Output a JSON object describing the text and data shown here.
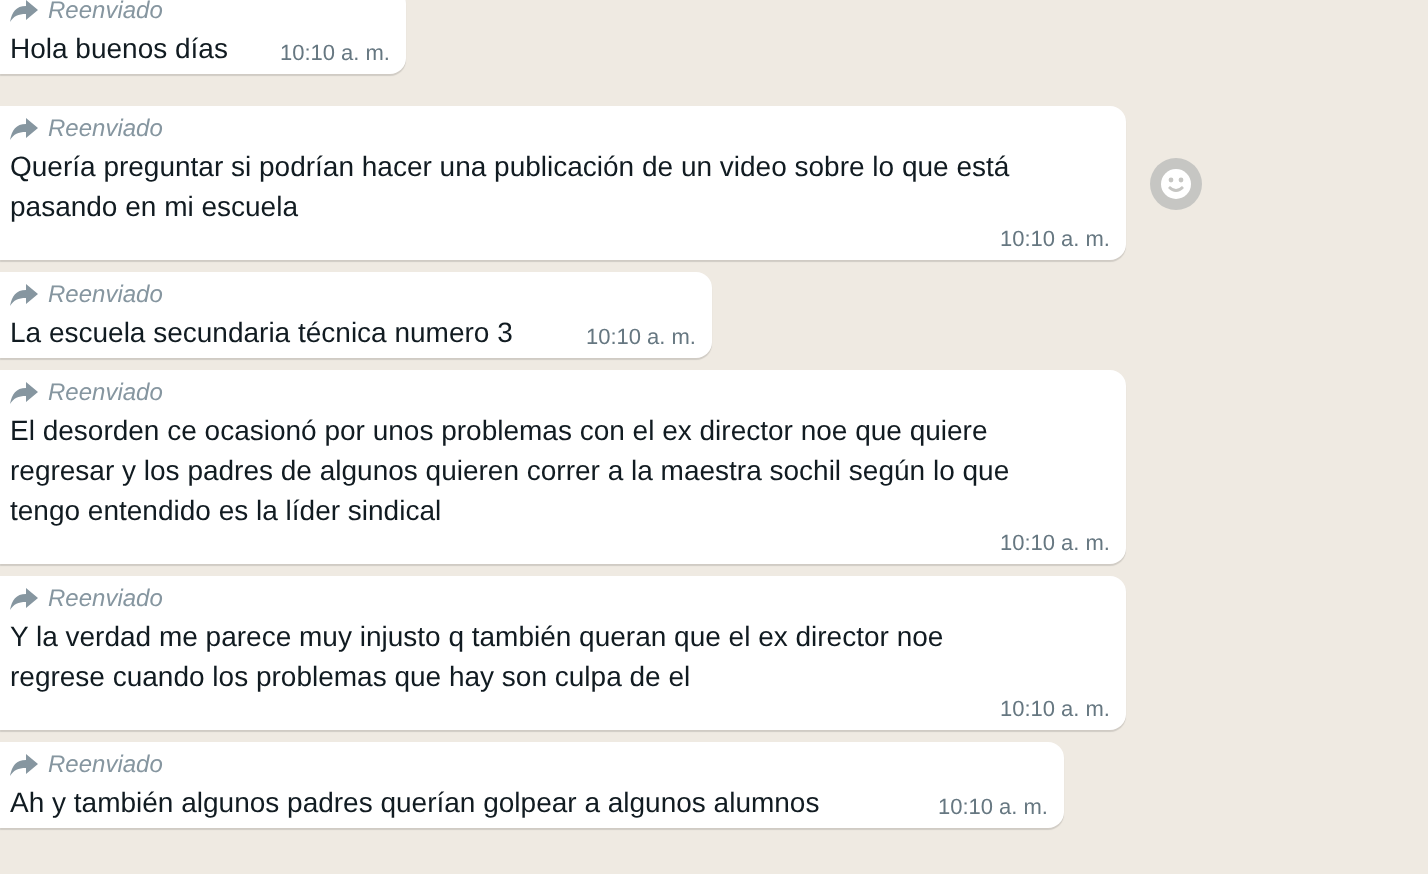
{
  "messages": [
    {
      "forwarded_label": "Reenviado",
      "text": "Hola buenos días",
      "time": "10:10 a. m."
    },
    {
      "forwarded_label": "Reenviado",
      "text": "Quería preguntar si podrían hacer una publicación de un video sobre lo que está pasando en mi escuela",
      "time": "10:10 a. m.",
      "reaction_button": true
    },
    {
      "forwarded_label": "Reenviado",
      "text": "La escuela secundaria técnica numero 3",
      "time": "10:10 a. m."
    },
    {
      "forwarded_label": "Reenviado",
      "text": "El desorden ce ocasionó por unos problemas con el ex director noe que quiere regresar y los padres de algunos quieren correr a la maestra sochil según lo que tengo entendido es la líder sindical",
      "time": "10:10 a. m."
    },
    {
      "forwarded_label": "Reenviado",
      "text": "Y la verdad me parece muy injusto q también queran que el ex director noe regrese cuando los problemas que hay son culpa de el",
      "time": "10:10 a. m."
    },
    {
      "forwarded_label": "Reenviado",
      "text": "Ah y también algunos padres querían golpear a algunos alumnos",
      "time": "10:10 a. m."
    }
  ]
}
